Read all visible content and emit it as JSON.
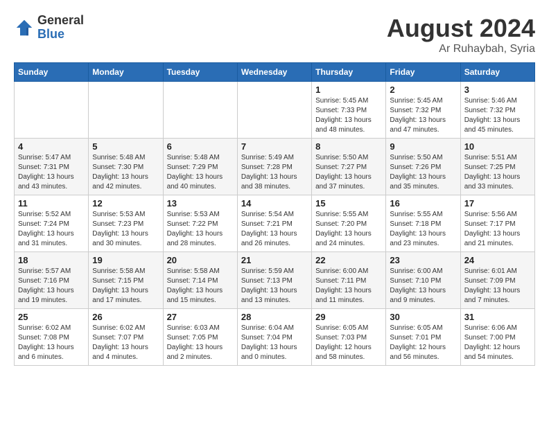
{
  "header": {
    "logo_general": "General",
    "logo_blue": "Blue",
    "month_title": "August 2024",
    "subtitle": "Ar Ruhaybah, Syria"
  },
  "weekdays": [
    "Sunday",
    "Monday",
    "Tuesday",
    "Wednesday",
    "Thursday",
    "Friday",
    "Saturday"
  ],
  "weeks": [
    [
      {
        "day": "",
        "info": ""
      },
      {
        "day": "",
        "info": ""
      },
      {
        "day": "",
        "info": ""
      },
      {
        "day": "",
        "info": ""
      },
      {
        "day": "1",
        "info": "Sunrise: 5:45 AM\nSunset: 7:33 PM\nDaylight: 13 hours\nand 48 minutes."
      },
      {
        "day": "2",
        "info": "Sunrise: 5:45 AM\nSunset: 7:32 PM\nDaylight: 13 hours\nand 47 minutes."
      },
      {
        "day": "3",
        "info": "Sunrise: 5:46 AM\nSunset: 7:32 PM\nDaylight: 13 hours\nand 45 minutes."
      }
    ],
    [
      {
        "day": "4",
        "info": "Sunrise: 5:47 AM\nSunset: 7:31 PM\nDaylight: 13 hours\nand 43 minutes."
      },
      {
        "day": "5",
        "info": "Sunrise: 5:48 AM\nSunset: 7:30 PM\nDaylight: 13 hours\nand 42 minutes."
      },
      {
        "day": "6",
        "info": "Sunrise: 5:48 AM\nSunset: 7:29 PM\nDaylight: 13 hours\nand 40 minutes."
      },
      {
        "day": "7",
        "info": "Sunrise: 5:49 AM\nSunset: 7:28 PM\nDaylight: 13 hours\nand 38 minutes."
      },
      {
        "day": "8",
        "info": "Sunrise: 5:50 AM\nSunset: 7:27 PM\nDaylight: 13 hours\nand 37 minutes."
      },
      {
        "day": "9",
        "info": "Sunrise: 5:50 AM\nSunset: 7:26 PM\nDaylight: 13 hours\nand 35 minutes."
      },
      {
        "day": "10",
        "info": "Sunrise: 5:51 AM\nSunset: 7:25 PM\nDaylight: 13 hours\nand 33 minutes."
      }
    ],
    [
      {
        "day": "11",
        "info": "Sunrise: 5:52 AM\nSunset: 7:24 PM\nDaylight: 13 hours\nand 31 minutes."
      },
      {
        "day": "12",
        "info": "Sunrise: 5:53 AM\nSunset: 7:23 PM\nDaylight: 13 hours\nand 30 minutes."
      },
      {
        "day": "13",
        "info": "Sunrise: 5:53 AM\nSunset: 7:22 PM\nDaylight: 13 hours\nand 28 minutes."
      },
      {
        "day": "14",
        "info": "Sunrise: 5:54 AM\nSunset: 7:21 PM\nDaylight: 13 hours\nand 26 minutes."
      },
      {
        "day": "15",
        "info": "Sunrise: 5:55 AM\nSunset: 7:20 PM\nDaylight: 13 hours\nand 24 minutes."
      },
      {
        "day": "16",
        "info": "Sunrise: 5:55 AM\nSunset: 7:18 PM\nDaylight: 13 hours\nand 23 minutes."
      },
      {
        "day": "17",
        "info": "Sunrise: 5:56 AM\nSunset: 7:17 PM\nDaylight: 13 hours\nand 21 minutes."
      }
    ],
    [
      {
        "day": "18",
        "info": "Sunrise: 5:57 AM\nSunset: 7:16 PM\nDaylight: 13 hours\nand 19 minutes."
      },
      {
        "day": "19",
        "info": "Sunrise: 5:58 AM\nSunset: 7:15 PM\nDaylight: 13 hours\nand 17 minutes."
      },
      {
        "day": "20",
        "info": "Sunrise: 5:58 AM\nSunset: 7:14 PM\nDaylight: 13 hours\nand 15 minutes."
      },
      {
        "day": "21",
        "info": "Sunrise: 5:59 AM\nSunset: 7:13 PM\nDaylight: 13 hours\nand 13 minutes."
      },
      {
        "day": "22",
        "info": "Sunrise: 6:00 AM\nSunset: 7:11 PM\nDaylight: 13 hours\nand 11 minutes."
      },
      {
        "day": "23",
        "info": "Sunrise: 6:00 AM\nSunset: 7:10 PM\nDaylight: 13 hours\nand 9 minutes."
      },
      {
        "day": "24",
        "info": "Sunrise: 6:01 AM\nSunset: 7:09 PM\nDaylight: 13 hours\nand 7 minutes."
      }
    ],
    [
      {
        "day": "25",
        "info": "Sunrise: 6:02 AM\nSunset: 7:08 PM\nDaylight: 13 hours\nand 6 minutes."
      },
      {
        "day": "26",
        "info": "Sunrise: 6:02 AM\nSunset: 7:07 PM\nDaylight: 13 hours\nand 4 minutes."
      },
      {
        "day": "27",
        "info": "Sunrise: 6:03 AM\nSunset: 7:05 PM\nDaylight: 13 hours\nand 2 minutes."
      },
      {
        "day": "28",
        "info": "Sunrise: 6:04 AM\nSunset: 7:04 PM\nDaylight: 13 hours\nand 0 minutes."
      },
      {
        "day": "29",
        "info": "Sunrise: 6:05 AM\nSunset: 7:03 PM\nDaylight: 12 hours\nand 58 minutes."
      },
      {
        "day": "30",
        "info": "Sunrise: 6:05 AM\nSunset: 7:01 PM\nDaylight: 12 hours\nand 56 minutes."
      },
      {
        "day": "31",
        "info": "Sunrise: 6:06 AM\nSunset: 7:00 PM\nDaylight: 12 hours\nand 54 minutes."
      }
    ]
  ]
}
